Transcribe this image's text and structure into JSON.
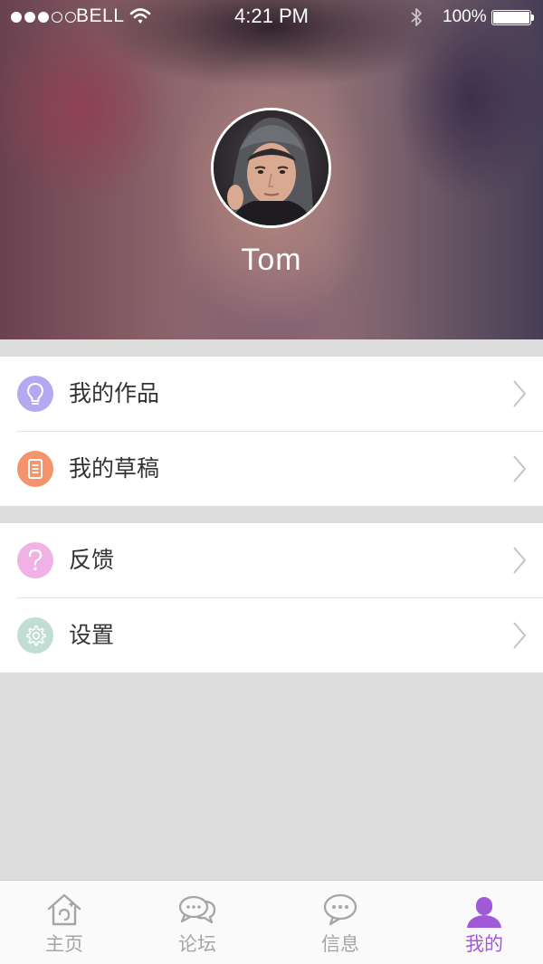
{
  "status_bar": {
    "carrier": "BELL",
    "time": "4:21 PM",
    "battery": "100%"
  },
  "profile": {
    "username": "Tom"
  },
  "menu": {
    "groups": [
      [
        {
          "label": "我的作品",
          "icon": "lightbulb-icon",
          "color": "#b3a9f0"
        },
        {
          "label": "我的草稿",
          "icon": "document-icon",
          "color": "#f4946c"
        }
      ],
      [
        {
          "label": "反馈",
          "icon": "question-icon",
          "color": "#f0b2e4"
        },
        {
          "label": "设置",
          "icon": "gear-icon",
          "color": "#c2dcd6"
        }
      ]
    ]
  },
  "tabbar": {
    "active_color": "#a05ad8",
    "inactive_color": "#a5a5a5",
    "tabs": [
      {
        "label": "主页",
        "icon": "home-icon"
      },
      {
        "label": "论坛",
        "icon": "forum-icon"
      },
      {
        "label": "信息",
        "icon": "message-icon"
      },
      {
        "label": "我的",
        "icon": "profile-icon",
        "active": true
      }
    ]
  }
}
